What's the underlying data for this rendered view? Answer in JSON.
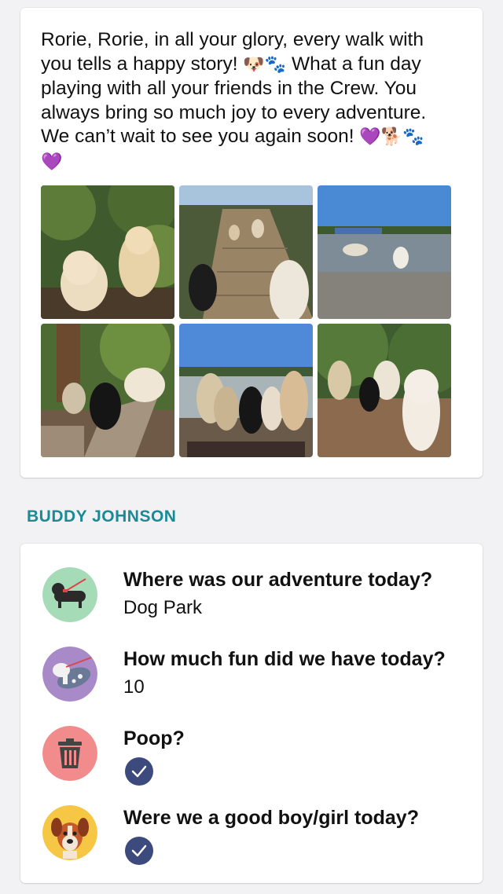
{
  "message": {
    "line1": "Rorie, Rorie, in all your glory, every walk with",
    "line2_before": "you tells a happy story! ",
    "line2_emoji": "🐶🐾",
    "line2_after": " What a fun day",
    "line3": "playing with all your friends in the Crew. You",
    "line4": "always bring so much joy to every adventure.",
    "line5_text": "We can’t wait to see you again soon! ",
    "line5_emoji": "💜🐕🐾",
    "line6_emoji": "💜"
  },
  "photos": [
    "two-golden-dogs-in-bushes",
    "dogs-on-wooden-dock",
    "dogs-in-lake-water",
    "dogs-on-log-bench",
    "doodle-group-by-water",
    "dogs-in-forest-trail"
  ],
  "owner": {
    "name": "BUDDY JOHNSON"
  },
  "report": {
    "items": [
      {
        "icon": "dachshund-icon",
        "question": "Where was our adventure today?",
        "answer": "Dog Park"
      },
      {
        "icon": "running-dog-icon",
        "question": "How much fun did we have today?",
        "answer": "10"
      },
      {
        "icon": "trash-can-icon",
        "question": "Poop?",
        "answer_icon": "checkmark-icon"
      },
      {
        "icon": "dog-face-icon",
        "question": "Were we a good boy/girl today?",
        "answer_icon": "checkmark-icon"
      }
    ]
  },
  "colors": {
    "accent": "#1a8a96",
    "check_badge": "#3c4a7d",
    "icon_green": "#a6dbb8",
    "icon_purple": "#a98ac9",
    "icon_red": "#f28b8b",
    "icon_yellow": "#f6c745"
  }
}
